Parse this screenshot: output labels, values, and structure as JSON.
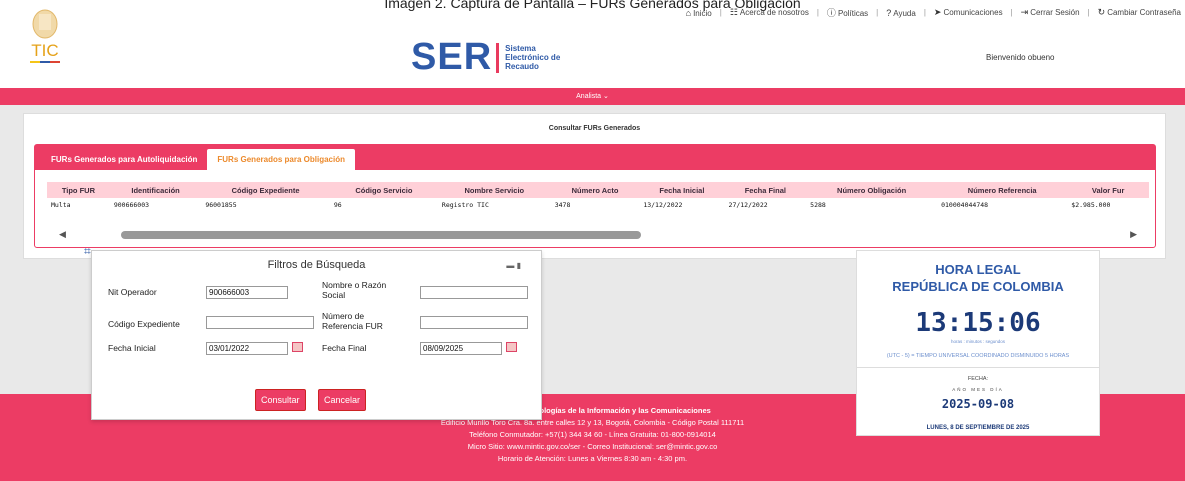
{
  "caption": "Imagen 2. Captura de Pantalla – FURs Generados para Obligación",
  "topnav": [
    {
      "icon": "home-icon",
      "label": "Inicio"
    },
    {
      "icon": "people-icon",
      "label": "Acerca de nosotros"
    },
    {
      "icon": "info-icon",
      "label": "Políticas"
    },
    {
      "icon": "help-icon",
      "label": "Ayuda"
    },
    {
      "icon": "send-icon",
      "label": "Comunicaciones"
    },
    {
      "icon": "logout-icon",
      "label": "Cerrar Sesión"
    },
    {
      "icon": "refresh-icon",
      "label": "Cambiar Contraseña"
    }
  ],
  "logo": {
    "text": "TIC"
  },
  "brand": {
    "name": "SER",
    "sub1": "Sistema",
    "sub2": "Electrónico de",
    "sub3": "Recaudo"
  },
  "welcome": "Bienvenido obueno",
  "menu": {
    "label": "Analista ⌄"
  },
  "card": {
    "title": "Consultar FURs Generados",
    "tabs": [
      "FURs Generados para Autoliquidación",
      "FURs Generados para Obligación"
    ],
    "columns": [
      "Tipo FUR",
      "Identificación",
      "Código Expediente",
      "Código Servicio",
      "Nombre Servicio",
      "Número Acto",
      "Fecha Inicial",
      "Fecha Final",
      "Número Obligación",
      "Número Referencia",
      "Valor Fur"
    ],
    "rows": [
      [
        "Multa",
        "900666003",
        "96001855",
        "96",
        "Registro TIC",
        "3478",
        "13/12/2022",
        "27/12/2022",
        "5288",
        "010004044748",
        "$2.985.000"
      ]
    ]
  },
  "filter": {
    "title": "Filtros de Búsqueda",
    "nit_label": "Nit Operador",
    "nit_value": "900666003",
    "razon_label": "Nombre o Razón Social",
    "razon_value": "",
    "exp_label": "Código Expediente",
    "exp_value": "",
    "ref_label": "Número de Referencia FUR",
    "ref_value": "",
    "fi_label": "Fecha Inicial",
    "fi_value": "03/01/2022",
    "ff_label": "Fecha Final",
    "ff_value": "08/09/2025",
    "consultar": "Consultar",
    "cancelar": "Cancelar"
  },
  "footer": {
    "l1": "Ministerio de Tecnologías de la Información y las Comunicaciones",
    "l2": "Edificio Murillo Toro Cra. 8a. entre calles 12 y 13, Bogotá, Colombia - Código Postal 111711",
    "l3": "Teléfono Conmutador: +57(1) 344 34 60 - Línea Gratuita: 01-800-0914014",
    "l4": "Micro Sitio: www.mintic.gov.co/ser - Correo Institucional: ser@mintic.gov.co",
    "l5": "Horario de Atención: Lunes a Viernes 8:30 am - 4:30 pm."
  },
  "clock": {
    "title1": "HORA LEGAL",
    "title2": "REPÚBLICA DE COLOMBIA",
    "time": "13:15:06",
    "units": "horas : minutos : segundos",
    "utc": "(UTC - 5) = TIEMPO UNIVERSAL COORDINADO DISMINUIDO 5 HORAS",
    "fecha_label": "FECHA:",
    "ymd": "AÑO  MES  DÍA",
    "date": "2025-09-08",
    "long": "LUNES, 8 DE SEPTIEMBRE DE 2025"
  },
  "colors": {
    "accent": "#ec3c64",
    "brand": "#2f5aa7",
    "tab_active_text": "#ec8a2c"
  }
}
